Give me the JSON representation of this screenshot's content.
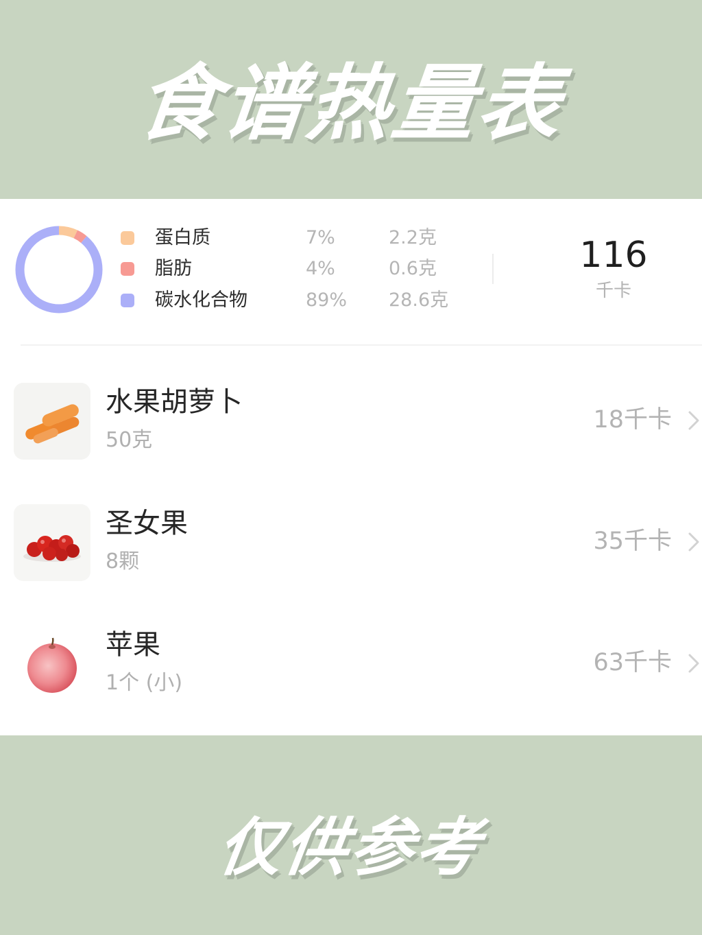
{
  "banner": {
    "title": "食谱热量表",
    "footer": "仅供参考"
  },
  "summary": {
    "macros": [
      {
        "name": "蛋白质",
        "percent": "7%",
        "amount": "2.2克",
        "share": 0.07,
        "color": "#fbc99a",
        "icon": "square-dot"
      },
      {
        "name": "脂肪",
        "percent": "4%",
        "amount": "0.6克",
        "share": 0.04,
        "color": "#f79a93",
        "icon": "square-dot"
      },
      {
        "name": "碳水化合物",
        "percent": "89%",
        "amount": "28.6克",
        "share": 0.89,
        "color": "#abaff8",
        "icon": "square-dot"
      }
    ],
    "total_kcal": "116",
    "kcal_unit": "千卡"
  },
  "foods": [
    {
      "name": "水果胡萝卜",
      "quantity": "50克",
      "kcal": "18千卡",
      "icon": "carrot-image"
    },
    {
      "name": "圣女果",
      "quantity": "8颗",
      "kcal": "35千卡",
      "icon": "cherry-tomato-image"
    },
    {
      "name": "苹果",
      "quantity": "1个 (小)",
      "kcal": "63千卡",
      "icon": "apple-image"
    }
  ]
}
